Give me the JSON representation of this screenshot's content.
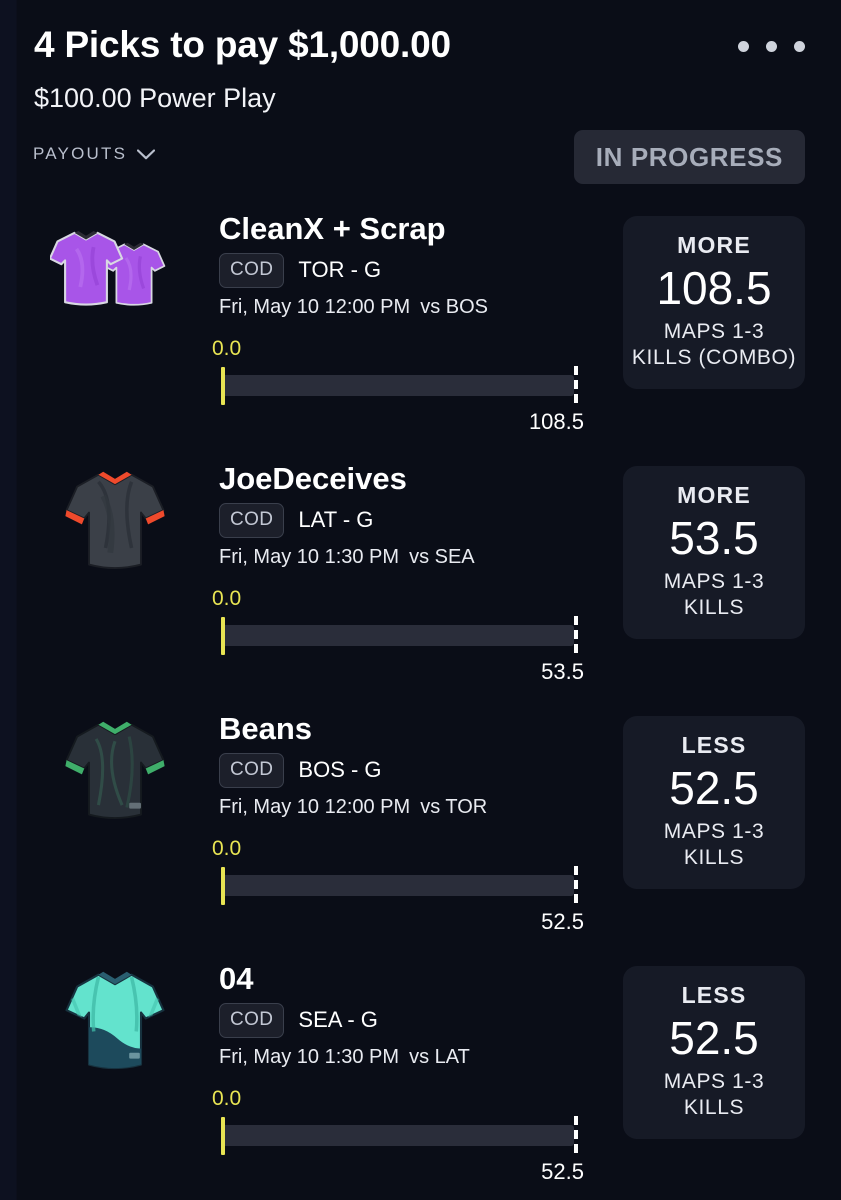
{
  "header": {
    "title": "4 Picks to pay $1,000.00",
    "subtitle": "$100.00 Power Play",
    "payouts_label": "PAYOUTS",
    "status": "IN PROGRESS",
    "chevron_icon": "chevron-down-icon",
    "more_icon": "kebab-menu-icon"
  },
  "picks": [
    {
      "player": "CleanX + Scrap",
      "league": "COD",
      "team_position": "TOR - G",
      "game": "Fri, May 10 12:00 PM",
      "opponent": "vs BOS",
      "current_value": "0.0",
      "goal_value": "108.5",
      "progress_percent": 0,
      "jersey_icon": "jersey-icon-combo-purple",
      "jersey_colors": {
        "body": "#a855e8",
        "trim": "#d9d9e0",
        "collar": "#2b2b34"
      },
      "stat": {
        "direction": "MORE",
        "line": "108.5",
        "type": "MAPS 1-3 KILLS (COMBO)"
      }
    },
    {
      "player": "JoeDeceives",
      "league": "COD",
      "team_position": "LAT - G",
      "game": "Fri, May 10 1:30 PM",
      "opponent": "vs SEA",
      "current_value": "0.0",
      "goal_value": "53.5",
      "progress_percent": 0,
      "jersey_icon": "jersey-icon-dark-red",
      "jersey_colors": {
        "body": "#3b4048",
        "trim": "#ef4a2c",
        "collar": "#ef4a2c"
      },
      "stat": {
        "direction": "MORE",
        "line": "53.5",
        "type": "MAPS 1-3 KILLS"
      }
    },
    {
      "player": "Beans",
      "league": "COD",
      "team_position": "BOS - G",
      "game": "Fri, May 10 12:00 PM",
      "opponent": "vs TOR",
      "current_value": "0.0",
      "goal_value": "52.5",
      "progress_percent": 0,
      "jersey_icon": "jersey-icon-dark-green",
      "jersey_colors": {
        "body": "#293038",
        "trim": "#3fae6a",
        "collar": "#3fae6a"
      },
      "stat": {
        "direction": "LESS",
        "line": "52.5",
        "type": "MAPS 1-3 KILLS"
      }
    },
    {
      "player": "04",
      "league": "COD",
      "team_position": "SEA - G",
      "game": "Fri, May 10 1:30 PM",
      "opponent": "vs LAT",
      "current_value": "0.0",
      "goal_value": "52.5",
      "progress_percent": 0,
      "jersey_icon": "jersey-icon-teal-navy",
      "jersey_colors": {
        "body": "#63e3cd",
        "trim": "#1d4a5c",
        "collar": "#1d4a5c"
      },
      "stat": {
        "direction": "LESS",
        "line": "52.5",
        "type": "MAPS 1-3 KILLS"
      }
    }
  ],
  "colors": {
    "background": "#0a0d17",
    "card": "#161a26",
    "accent_yellow": "#e8e453",
    "track": "#2a2d3a",
    "badge": "#262935"
  }
}
